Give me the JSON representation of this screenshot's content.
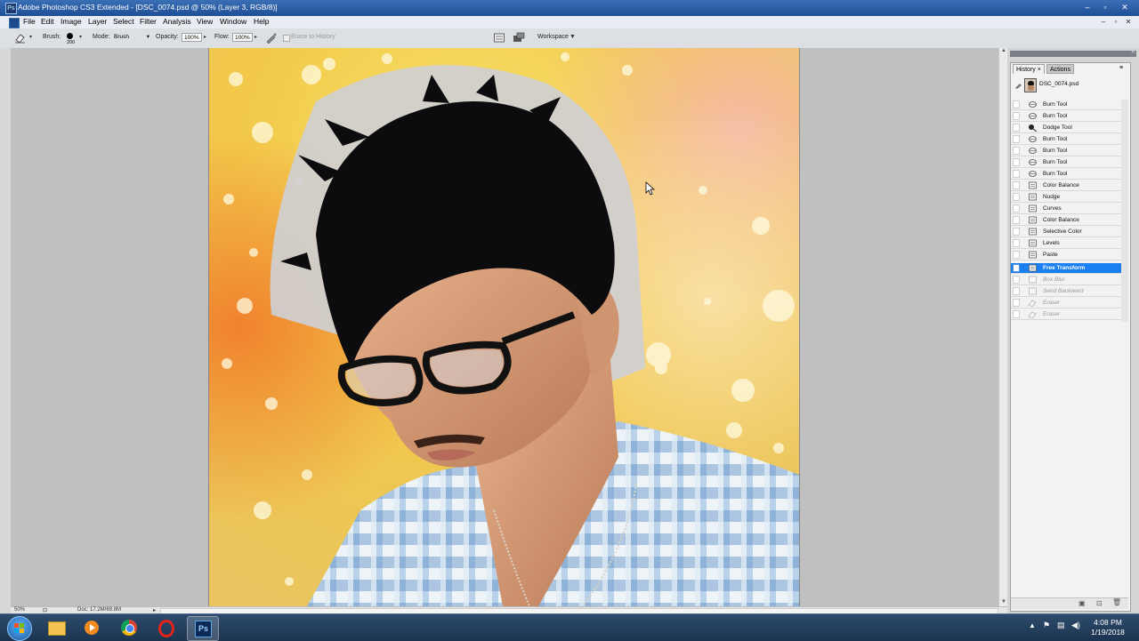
{
  "window": {
    "title": "Adobe Photoshop CS3 Extended - [DSC_0074.psd @ 50% (Layer 3, RGB/8)]",
    "logo_text": "Ps"
  },
  "menu": [
    "File",
    "Edit",
    "Image",
    "Layer",
    "Select",
    "Filter",
    "Analysis",
    "View",
    "Window",
    "Help"
  ],
  "options": {
    "brush_label": "Brush:",
    "brush_size": "200",
    "mode_label": "Mode:",
    "mode_value": "Brush",
    "opacity_label": "Opacity:",
    "opacity_value": "100%",
    "flow_label": "Flow:",
    "flow_value": "100%",
    "erase_to_history": "Erase to History",
    "workspace_label": "Workspace"
  },
  "status": {
    "zoom": "50%",
    "doc": "Doc: 17.2M/69.8M"
  },
  "panel": {
    "tabs": [
      "History",
      "Actions"
    ],
    "snapshot_name": "DSC_0074.psd",
    "history": [
      {
        "label": "Burn Tool",
        "icon": "burn-icon",
        "state": "normal"
      },
      {
        "label": "Burn Tool",
        "icon": "burn-icon",
        "state": "normal"
      },
      {
        "label": "Dodge Tool",
        "icon": "dodge-icon",
        "state": "normal"
      },
      {
        "label": "Burn Tool",
        "icon": "burn-icon",
        "state": "normal"
      },
      {
        "label": "Burn Tool",
        "icon": "burn-icon",
        "state": "normal"
      },
      {
        "label": "Burn Tool",
        "icon": "burn-icon",
        "state": "normal"
      },
      {
        "label": "Burn Tool",
        "icon": "burn-icon",
        "state": "normal"
      },
      {
        "label": "Color Balance",
        "icon": "adjustment-icon",
        "state": "normal"
      },
      {
        "label": "Nudge",
        "icon": "adjustment-icon",
        "state": "normal"
      },
      {
        "label": "Curves",
        "icon": "adjustment-icon",
        "state": "normal"
      },
      {
        "label": "Color Balance",
        "icon": "adjustment-icon",
        "state": "normal"
      },
      {
        "label": "Selective Color",
        "icon": "adjustment-icon",
        "state": "normal"
      },
      {
        "label": "Levels",
        "icon": "adjustment-icon",
        "state": "normal"
      },
      {
        "label": "Paste",
        "icon": "adjustment-icon",
        "state": "normal"
      },
      {
        "label": "Free Transform",
        "icon": "adjustment-icon",
        "state": "active"
      },
      {
        "label": "Box Blur",
        "icon": "adjustment-icon",
        "state": "inactive"
      },
      {
        "label": "Send Backward",
        "icon": "adjustment-icon",
        "state": "inactive"
      },
      {
        "label": "Eraser",
        "icon": "eraser-icon",
        "state": "inactive"
      },
      {
        "label": "Eraser",
        "icon": "eraser-icon",
        "state": "inactive"
      }
    ]
  },
  "taskbar": {
    "apps": [
      "start-orb",
      "explorer",
      "media-player",
      "chrome",
      "opera",
      "photoshop"
    ],
    "photoshop_label": "Ps",
    "time": "4:08 PM",
    "date": "1/19/2018"
  },
  "colors": {
    "title_bar": "#2a5ea6",
    "active_history": "#1a7ff0",
    "workspace_gray": "#c0c0c0"
  }
}
